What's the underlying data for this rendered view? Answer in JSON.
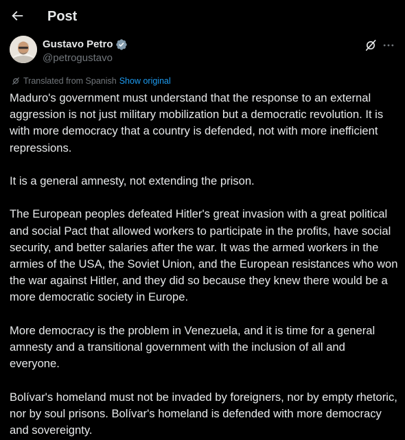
{
  "header": {
    "title": "Post",
    "back_icon": "arrow-left-icon"
  },
  "author": {
    "name": "Gustavo Petro",
    "handle": "@petrogustavo",
    "verified_icon": "verified-badge-icon",
    "verified_color": "#829aab"
  },
  "actions": {
    "grok_icon": "grok-icon",
    "more_icon": "more-horizontal-icon"
  },
  "translation": {
    "label": "Translated from Spanish",
    "link": "Show original",
    "icon": "grok-translate-icon"
  },
  "post": {
    "paragraphs": [
      "Maduro's government must understand that the response to an external aggression is not just military mobilization but a democratic revolution. It is with more democracy that a country is defended, not with more inefficient repressions.",
      "It is a general amnesty, not extending the prison.",
      "The European peoples defeated Hitler's great invasion with a great political and social Pact that allowed workers to participate in the profits, have social security, and better salaries after the war. It was the armed workers in the armies of the USA, the Soviet Union, and the European resistances who won the war against Hitler, and they did so because they knew there would be a more democratic society in Europe.",
      "More democracy is the problem in Venezuela, and it is time for a general amnesty and a transitional government with the inclusion of all and everyone.",
      "Bolívar's homeland must not be invaded by foreigners, nor by empty rhetoric, nor by soul prisons. Bolívar's homeland is defended with more democracy and sovereignty."
    ]
  },
  "colors": {
    "background": "#000000",
    "text": "#e7e9ea",
    "secondary": "#71767b",
    "link": "#1d9bf0"
  }
}
